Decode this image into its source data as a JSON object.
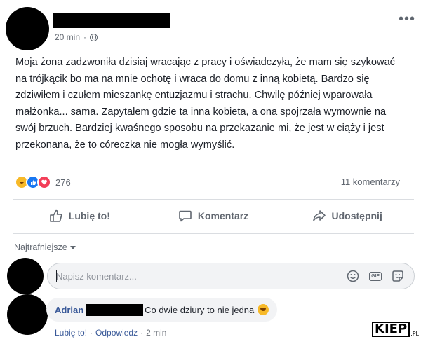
{
  "post": {
    "time": "20 min",
    "privacy_icon": "globe-icon",
    "more_label": "•••",
    "body": "Moja żona zadzwoniła dzisiaj wracając z pracy i oświadczyła, że mam się szykować na trójkącik bo ma na mnie ochotę i wraca do domu z inną kobietą. Bardzo się zdziwiłem i czułem mieszankę entuzjazmu i strachu. Chwilę później wparowała małżonka... sama. Zapytałem gdzie ta inna kobieta, a ona spojrzała wymownie na swój brzuch. Bardziej kwaśnego sposobu na przekazanie mi, że jest w ciąży i jest przekonana, że to córeczka nie mogła wymyślić.",
    "reaction_icons": [
      "haha-reaction-icon",
      "like-reaction-icon",
      "love-reaction-icon"
    ],
    "reaction_count": "276",
    "comments_count": "11 komentarzy"
  },
  "actions": {
    "like": "Lubię to!",
    "comment": "Komentarz",
    "share": "Udostępnij"
  },
  "comments": {
    "sort_label": "Najtrafniejsze",
    "input_placeholder": "Napisz komentarz...",
    "input_icons": [
      "emoji-icon",
      "gif-icon",
      "sticker-icon"
    ],
    "items": [
      {
        "author": "Adrian",
        "text": "Co dwie dziury to nie jedna",
        "like": "Lubię to!",
        "reply": "Odpowiedz",
        "time": "2 min"
      }
    ]
  },
  "watermark": {
    "main": "KIEP",
    "suffix": ".PL"
  },
  "colors": {
    "link": "#385898",
    "muted": "#616770",
    "like_blue": "#1877f2",
    "love_red": "#f33e58",
    "haha_yellow": "#f7b928"
  }
}
